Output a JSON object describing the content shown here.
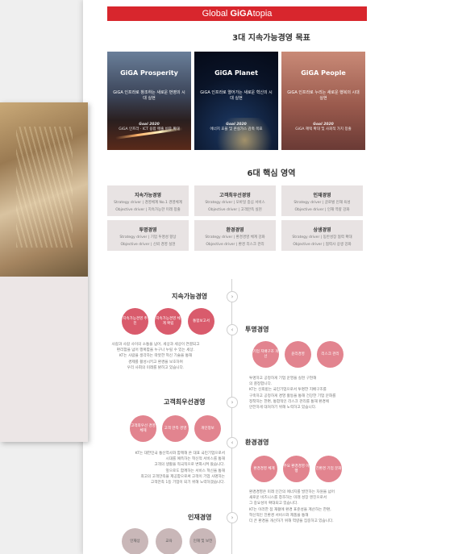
{
  "header": {
    "brand_prefix": "Global ",
    "brand_giga": "GiGA",
    "brand_suffix": "topia"
  },
  "goals": {
    "title": "3대 지속가능경영 목표",
    "cards": [
      {
        "title": "GiGA Prosperity",
        "subtitle": "GiGA 인프라로 창조하는 새로운 번영의 시대 실현",
        "goal_label": "Goal 2020",
        "goal_text": "GiGA 인프라 · ICT 융합 매출 비중 확대"
      },
      {
        "title": "GiGA Planet",
        "subtitle": "GiGA 인프라로 열어가는 새로운 혁신의 시대 실현",
        "goal_label": "Goal 2020",
        "goal_text": "에너지 효율 및 온실가스 감축 목표"
      },
      {
        "title": "GiGA People",
        "subtitle": "GiGA 인프라로 누리는 새로운 행복의 시대 실현",
        "goal_label": "Goal 2020",
        "goal_text": "GiGA 혜택 확대 및 사회적 가치 창출"
      }
    ]
  },
  "areas": {
    "title": "6대 핵심 영역",
    "items": [
      {
        "title": "지속가능경영",
        "line1": "Strategy driver | 경영체계 No.1 경영체계",
        "line2": "Objective driver | 지속가능한 미래 창출"
      },
      {
        "title": "고객최우선경영",
        "line1": "Strategy driver | 모바일 중심 서비스",
        "line2": "Objective driver | 고객만족 실현"
      },
      {
        "title": "인재경영",
        "line1": "Strategy driver | 글로벌 인재 육성",
        "line2": "Objective driver | 인재 역량 강화"
      },
      {
        "title": "투명경영",
        "line1": "Strategy driver | 기업 투명성 향상",
        "line2": "Objective driver | 신뢰 경영 실현"
      },
      {
        "title": "환경경영",
        "line1": "Strategy driver | 환경경영 체계 강화",
        "line2": "Objective driver | 환경 리스크 관리"
      },
      {
        "title": "상생경영",
        "line1": "Strategy driver | 동반성장 협력 확대",
        "line2": "Objective driver | 협력사 상생 강화"
      }
    ]
  },
  "timeline": {
    "sections": [
      {
        "title": "지속가능경영",
        "circles": [
          "지속가능경영 추진",
          "지속가능경영 체계 확립",
          "통합보고서"
        ],
        "text": [
          "사람과 사람 사이의 소통을 넘어, 세상과 세상이 연결되고",
          "편리함을 넘어 행복함을 누구나 누릴 수 있는 세상.",
          "KT는 사람을 생각하는 따뜻한 혁신 기술을 통해",
          "경제를 활성시키고 환경을 보호하며",
          "우리 사회의 미래를 밝히고 있습니다."
        ]
      },
      {
        "title": "투명경영",
        "circles": [
          "기업 지배구조 개선",
          "윤리경영",
          "리스크 관리"
        ],
        "text": [
          "투명하고 공정하게 기업 운영을 실천 구현해",
          "의 결정합니다.",
          "KT는 신뢰받는 국민기업으로서 투명한 지배구조를",
          "구축하고 공정하게 경영 활동을 통해 건강한 기업 문화를",
          "정착하는 한편, 통합적인 리스크 관리를 통해 환경에",
          "안전하게 대처하기 위해 노력하고 있습니다."
        ]
      },
      {
        "title": "고객최우선경영",
        "circles": [
          "고객최우선 경영체제",
          "고객 만족 경영",
          "개인정보"
        ],
        "text": [
          "KT는 대한민국 통신역사와 함께해 온 대표 국민기업으로서",
          "시대를 예측하는 혁신적 서비스를 통해",
          "고객의 생활을 적극적으로 변화시켜 왔습니다.",
          "앞으로도 함께하는 서비스 혁신을 통해",
          "최고의 고객만족을 제공함으로써 고객이 기업 사명하는",
          "고객만족 1등 기업이 되기 위해 노력하겠습니다."
        ]
      },
      {
        "title": "환경경영",
        "circles": [
          "환경경영 체계",
          "주요 환경경영 이행",
          "친환경 기업 문화"
        ],
        "text": [
          "환경경영은 미래 인간의 에너지를 발전하는 차원을 넘어",
          "새로운 비즈니스를 창조하는 미래 성장 엔진으로서",
          "그 중요성이 확대되고 있습니다.",
          "KT는 이러한 점 재활에 환경 표준성을 계산하는 한편,",
          "혁신적인 친환경 서비스와 제품을 통해",
          "더 큰 환경을 개선하기 위해 역량을 집중하고 있습니다."
        ]
      },
      {
        "title": "인재경영",
        "circles": [
          "인재상",
          "교육",
          "인재 및 보전"
        ],
        "text": []
      }
    ]
  }
}
